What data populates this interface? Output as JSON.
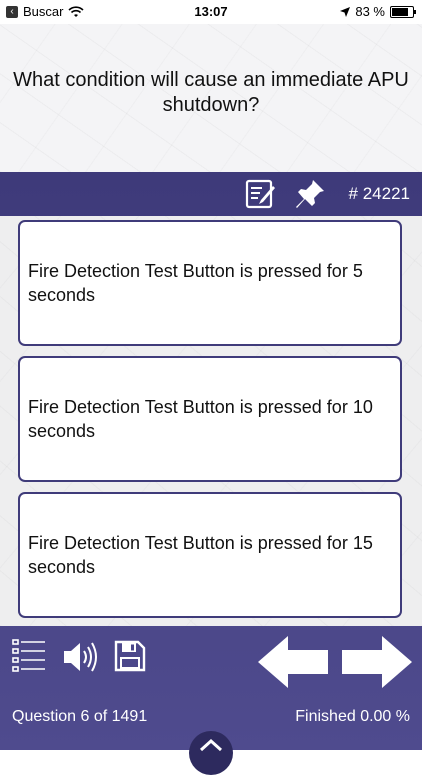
{
  "status_bar": {
    "carrier": "Buscar",
    "time": "13:07",
    "battery": "83 %"
  },
  "question": {
    "text": "What condition will cause an immediate APU shutdown?",
    "number": "# 24221"
  },
  "toolbar": {
    "icons": [
      "notes-icon",
      "pin-icon"
    ]
  },
  "answers": [
    {
      "text": "Fire Detection Test Button is pressed for 5 seconds"
    },
    {
      "text": "Fire Detection Test Button is pressed for 10 seconds"
    },
    {
      "text": "Fire Detection Test Button is pressed for 15 seconds"
    }
  ],
  "footer": {
    "progress": "Question 6 of 1491",
    "finished": "Finished 0.00 %"
  },
  "colors": {
    "accent": "#3e3a7a",
    "answer_bg": "#ffffff",
    "text": "#111111"
  }
}
